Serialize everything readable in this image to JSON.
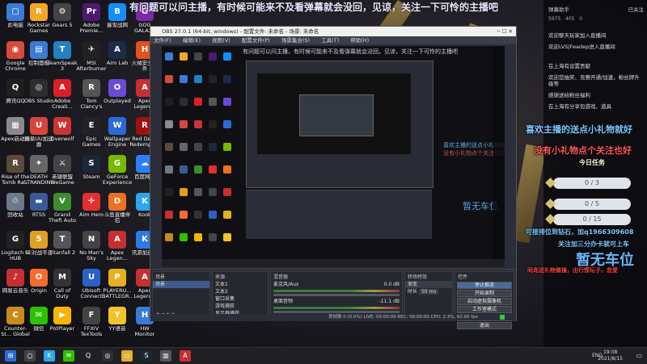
{
  "banner": "有问题可以问主播，有时候可能来不及看弹幕就会没回，见谅，关注一下可怜的主播吧",
  "desktop_icons": [
    {
      "label": "此电脑",
      "color": "#3b7bd6",
      "glyph": "▢"
    },
    {
      "label": "Google Chrome",
      "color": "#d64a3b",
      "glyph": "◉"
    },
    {
      "label": "腾讯QQ",
      "color": "#1f1f1f",
      "glyph": "Q"
    },
    {
      "label": "Apex启动器",
      "color": "#8a8a8a",
      "glyph": "▦"
    },
    {
      "label": "Rise of the Tomb Ra...",
      "color": "#5a4a3a",
      "glyph": "R"
    },
    {
      "label": "回收站",
      "color": "#6b7a8a",
      "glyph": "♲"
    },
    {
      "label": "Logitech G HUB",
      "color": "#222",
      "glyph": "G"
    },
    {
      "label": "网易云音乐",
      "color": "#c62f2f",
      "glyph": "♪"
    },
    {
      "label": "Counter-St... Global Off...",
      "color": "#c98a1a",
      "glyph": "C"
    },
    {
      "label": "Rockstar Games La...",
      "color": "#f5a623",
      "glyph": "R"
    },
    {
      "label": "控制面板",
      "color": "#3a7bd5",
      "glyph": "▤"
    },
    {
      "label": "OBS Studio",
      "color": "#2d2d2d",
      "glyph": "◎"
    },
    {
      "label": "网易UU加速器",
      "color": "#d8463b",
      "glyph": "U"
    },
    {
      "label": "DEATH STRANDING",
      "color": "#666",
      "glyph": "✦"
    },
    {
      "label": "RTSS",
      "color": "#3b5998",
      "glyph": "▬"
    },
    {
      "label": "5E对战平台",
      "color": "#e0a020",
      "glyph": "5"
    },
    {
      "label": "Origin",
      "color": "#f56c2d",
      "glyph": "O"
    },
    {
      "label": "微信",
      "color": "#2dc100",
      "glyph": "✉"
    },
    {
      "label": "Gears 5",
      "color": "#444",
      "glyph": "⚙"
    },
    {
      "label": "TeamSpeak 3",
      "color": "#2580c3",
      "glyph": "T"
    },
    {
      "label": "Adobe Creati...",
      "color": "#da1f26",
      "glyph": "A"
    },
    {
      "label": "Overwolf",
      "color": "#cc3333",
      "glyph": "W"
    },
    {
      "label": "英雄联盟WeGame",
      "color": "#444",
      "glyph": "⚔"
    },
    {
      "label": "Grand Theft Auto V",
      "color": "#3c8d2f",
      "glyph": "V"
    },
    {
      "label": "Titanfall 2",
      "color": "#555",
      "glyph": "T"
    },
    {
      "label": "Call of Duty Modern...",
      "color": "#333",
      "glyph": "M"
    },
    {
      "label": "PotPlayer",
      "color": "#f7b500",
      "glyph": "▶"
    },
    {
      "label": "Adobe Premie...",
      "color": "#4b1a6e",
      "glyph": "Pr"
    },
    {
      "label": "MSI Afterburner",
      "color": "#222",
      "glyph": "✈"
    },
    {
      "label": "Tom Clancy's R...",
      "color": "#555",
      "glyph": "R"
    },
    {
      "label": "Epic Games Launcher",
      "color": "#222",
      "glyph": "E"
    },
    {
      "label": "Steam",
      "color": "#1b2838",
      "glyph": "S"
    },
    {
      "label": "Aim Hero",
      "color": "#e03030",
      "glyph": "✛"
    },
    {
      "label": "No Man's Sky",
      "color": "#444",
      "glyph": "N"
    },
    {
      "label": "Ubisoft Connect",
      "color": "#2b60c5",
      "glyph": "U"
    },
    {
      "label": "FFXIV TexTools",
      "color": "#444",
      "glyph": "F"
    },
    {
      "label": "暴雪战网",
      "color": "#148eff",
      "glyph": "B"
    },
    {
      "label": "Aim Lab",
      "color": "#1d2b4a",
      "glyph": "A"
    },
    {
      "label": "Outplayed",
      "color": "#6a4ad6",
      "glyph": "O"
    },
    {
      "label": "Wallpaper Engine",
      "color": "#2a6ad6",
      "glyph": "W"
    },
    {
      "label": "GeForce Experience",
      "color": "#76b900",
      "glyph": "G"
    },
    {
      "label": "斗鱼直播伴侣",
      "color": "#f07020",
      "glyph": "D"
    },
    {
      "label": "Apex Legen...",
      "color": "#c62f2f",
      "glyph": "A"
    },
    {
      "label": "PLAYERU... BATTLEGR...",
      "color": "#e8b020",
      "glyph": "P"
    },
    {
      "label": "YY语音",
      "color": "#f4c32b",
      "glyph": "Y"
    },
    {
      "label": "GOG GALAXY",
      "color": "#7a2aa8",
      "glyph": "G"
    },
    {
      "label": "火绒安全软件",
      "color": "#e05020",
      "glyph": "H"
    },
    {
      "label": "Apex Legends",
      "color": "#c62f2f",
      "glyph": "A"
    },
    {
      "label": "Red Dead Redempti...",
      "color": "#a01010",
      "glyph": "R"
    },
    {
      "label": "百度网盘",
      "color": "#2d7ff9",
      "glyph": "☁"
    },
    {
      "label": "Kook",
      "color": "#2ca7f0",
      "glyph": "K"
    },
    {
      "label": "讯游加速器",
      "color": "#2c7be5",
      "glyph": "K"
    },
    {
      "label": "Apex Legends",
      "color": "#c62f2f",
      "glyph": "A"
    },
    {
      "label": "HW Monitor",
      "color": "#3a7bd5",
      "glyph": "H"
    },
    {
      "label": "其他",
      "color": "#5b7bc8",
      "glyph": "◈"
    }
  ],
  "obs": {
    "title": "OBS 27.0.1 (64-bit, windows) - 配置文件: 未命名 - 场景: 未命名",
    "menu": [
      "文件(F)",
      "编辑(E)",
      "视图(V)",
      "配置文件(P)",
      "场景集合(S)",
      "工具(T)",
      "帮助(H)"
    ],
    "preview_banner": "有问题可以问主播，有时候可能来不及看弹幕就会没回，见谅，关注一下可怜的主播吧",
    "scenes_header": "场景",
    "scene_selected": "场景",
    "sources_header": "来源",
    "sources": [
      "文本1",
      "文本2",
      "窗口采集",
      "游戏捕获",
      "显示器捕获"
    ],
    "mixer_header": "混音器",
    "mixer_tracks": [
      {
        "name": "麦克风/Aux",
        "db": "0.0 dB"
      },
      {
        "name": "桌面音频",
        "db": "-11.1 dB"
      }
    ],
    "transitions_header": "转场特效",
    "transition_value": "渐变",
    "duration_label": "时长",
    "duration_value": "50 ms",
    "controls_header": "控件",
    "controls": [
      "停止推流",
      "开始录制",
      "启动虚拟摄像机",
      "工作室模式",
      "设置",
      "退出"
    ],
    "status": "丢帧数 0 (0.0%)   LIVE: 00:00:00   REC: 00:00:00   CPU: 2.3%, 60.00 fps"
  },
  "chat": {
    "room_name": "弹幕助手",
    "top_right": "已关注",
    "stats": [
      "5975",
      "405",
      "0"
    ],
    "messages": [
      "欢迎聊天玩家加入直播间",
      "欢迎LVS|Feadep进入直播间",
      "在上海有设置贡献",
      "欢迎您抽奖、竞赛开通/加速，粉丝牌升级等",
      "感谢送给粉丝福利",
      "在上海有分享包游戏、道具"
    ]
  },
  "overlay": {
    "line1": "喜欢主播的送点小礼物就好",
    "line2": "没有小礼物点个关注也好",
    "task_title": "今日任务",
    "tasks": [
      "0 / 3",
      "0 / 5",
      "0 / 15"
    ],
    "contact": "可接排位到钻石，加q1966309608",
    "follow_hint": "关注加三分办卡就可上车",
    "no_seat": "暂无车位",
    "notice": "同岛送礼物做操，出行惯坛子，恋爱"
  },
  "taskbar": {
    "apps": [
      {
        "name": "start",
        "glyph": "⊞",
        "color": "#2a6ad6"
      },
      {
        "name": "search",
        "glyph": "○",
        "color": "#444"
      },
      {
        "name": "kook",
        "glyph": "K",
        "color": "#2ca7f0"
      },
      {
        "name": "wechat",
        "glyph": "✉",
        "color": "#2dc100"
      },
      {
        "name": "qq",
        "glyph": "Q",
        "color": "#222"
      },
      {
        "name": "obs",
        "glyph": "◎",
        "color": "#2d2d2d"
      },
      {
        "name": "folder",
        "glyph": "▭",
        "color": "#e0b030"
      },
      {
        "name": "steam",
        "glyph": "S",
        "color": "#1b2838"
      },
      {
        "name": "monitor",
        "glyph": "▥",
        "color": "#555"
      },
      {
        "name": "apex",
        "glyph": "A",
        "color": "#c62f2f"
      }
    ],
    "lang": "ENG",
    "time": "19:08",
    "date": "2021/8/15"
  }
}
